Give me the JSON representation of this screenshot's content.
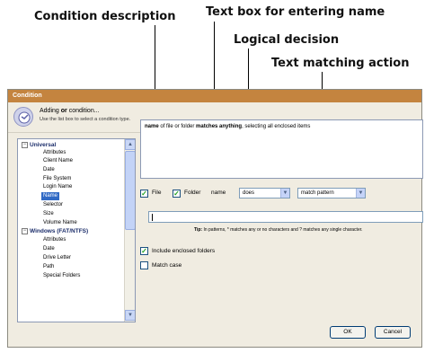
{
  "callouts": {
    "condition_description": "Condition description",
    "text_box_name": "Text box for entering name",
    "logical_decision": "Logical decision",
    "text_matching_action": "Text matching action"
  },
  "dialog": {
    "title": "Condition",
    "heading_bold_pre": "Adding ",
    "heading_bold": "or",
    "heading_post": " condition...",
    "subheading": "Use the list box to select a condition type.",
    "tree": {
      "groups": [
        {
          "label": "Universal",
          "toggle": "−",
          "items": [
            "Attributes",
            "Client Name",
            "Date",
            "File System",
            "Login Name",
            "Name",
            "Selector",
            "Size",
            "Volume Name"
          ]
        },
        {
          "label": "Windows (FAT/NTFS)",
          "toggle": "−",
          "items": [
            "Attributes",
            "Date",
            "Drive Letter",
            "Path",
            "Special Folders"
          ]
        }
      ],
      "selected_item": "Name"
    },
    "description": {
      "part1": "name",
      "part2": " of file or folder ",
      "part3": "matches anything",
      "part4": ", selecting all enclosed items"
    },
    "file_checkbox_label": "File",
    "folder_checkbox_label": "Folder",
    "name_label": "name",
    "logic_dropdown_value": "does",
    "match_dropdown_value": "match pattern",
    "name_input_value": "",
    "tip_label": "Tip:",
    "tip_text": " In patterns, * matches any or no characters and ? matches any single character.",
    "include_enclosed_label": "Include enclosed folders",
    "match_case_label": "Match case",
    "ok_label": "OK",
    "cancel_label": "Cancel",
    "accent_color": "#c4843f",
    "selection_color": "#316ac5"
  }
}
